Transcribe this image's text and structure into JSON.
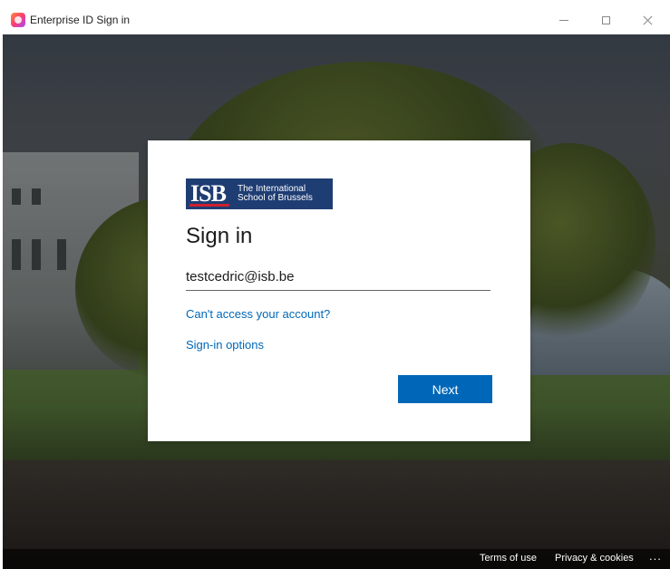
{
  "window": {
    "title": "Enterprise ID Sign in",
    "controls": {
      "minimize": "minimize",
      "maximize": "maximize",
      "close": "close"
    }
  },
  "logo": {
    "mark": "ISB",
    "line1": "The International",
    "line2": "School of Brussels",
    "colors": {
      "background": "#1e3d73",
      "accent": "#d0202e"
    }
  },
  "signin": {
    "heading": "Sign in",
    "email_value": "testcedric@isb.be",
    "cant_access_label": "Can't access your account?",
    "signin_options_label": "Sign-in options",
    "next_label": "Next"
  },
  "footer": {
    "terms_label": "Terms of use",
    "privacy_label": "Privacy & cookies",
    "more_label": "..."
  },
  "colors": {
    "accent": "#0067b8"
  }
}
